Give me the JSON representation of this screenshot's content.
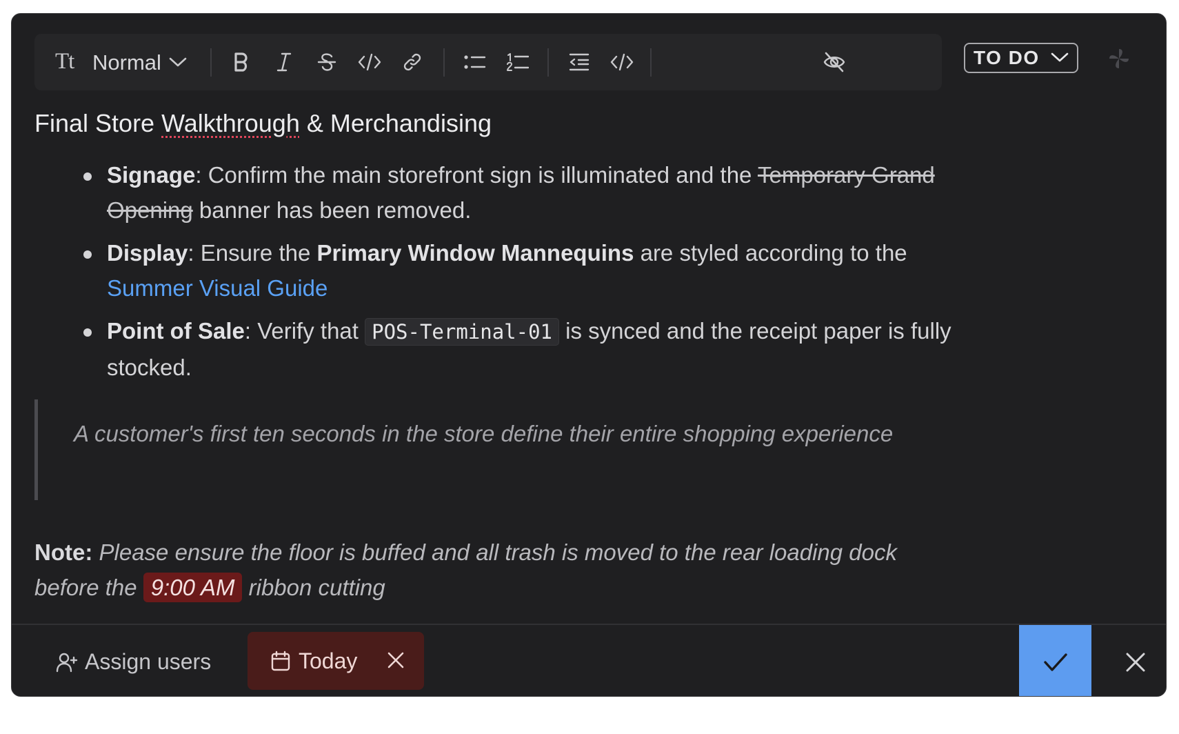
{
  "toolbar": {
    "format_icon": "Tt",
    "format_label": "Normal",
    "icons": [
      "text-format-icon",
      "chevron-down-icon",
      "bold-icon",
      "italic-icon",
      "strikethrough-icon",
      "inline-code-icon",
      "link-icon",
      "bullet-list-icon",
      "numbered-list-icon",
      "outdent-icon",
      "code-block-icon",
      "eye-off-icon"
    ]
  },
  "status": {
    "label": "TO DO"
  },
  "editor": {
    "title_before": "Final Store ",
    "title_misspelled": "Walkthrough",
    "title_after": " & Merchandising",
    "items": [
      {
        "label": "Signage",
        "text_1": ": Confirm the main storefront sign is illuminated and the ",
        "strike": "Temporary Grand Opening",
        "text_2": " banner has been removed."
      },
      {
        "label": "Display",
        "text_1": ": Ensure the ",
        "bold": "Primary Window Mannequins",
        "text_2": " are styled according to the ",
        "link": "Summer Visual Guide"
      },
      {
        "label": "Point of Sale",
        "text_1": ": Verify that ",
        "code": "POS-Terminal-01",
        "text_2": " is synced and the receipt paper is fully stocked."
      }
    ],
    "quote": "A customer's first ten seconds in the store define their entire shopping experience",
    "note": {
      "label": "Note:",
      "text_1": " Please ensure the floor is buffed and all trash is moved to the rear loading dock before the ",
      "time": "9:00 AM",
      "text_2": " ribbon cutting"
    }
  },
  "footer": {
    "assign_label": "Assign users",
    "due_label": "Today"
  },
  "colors": {
    "background": "#1f1f21",
    "link": "#5aa1f5",
    "save_button": "#5d9cf0",
    "due_chip": "#4a1c1a",
    "time_highlight": "#6b1a1a"
  }
}
